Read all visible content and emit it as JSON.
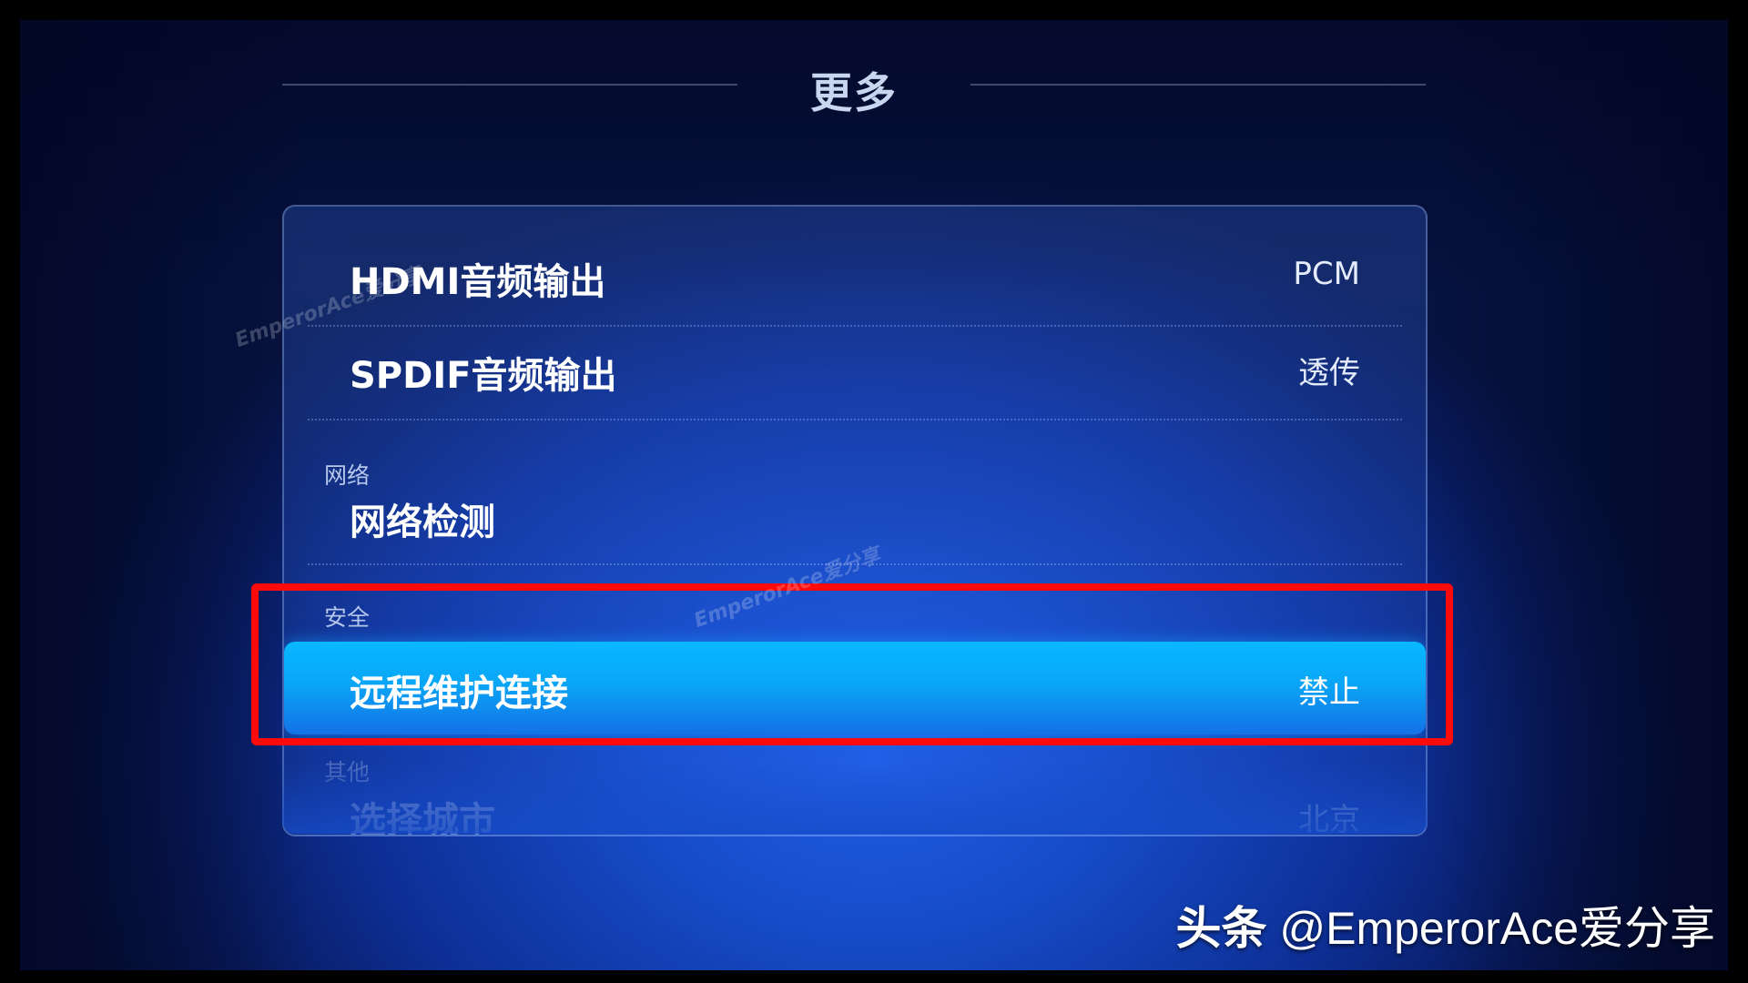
{
  "header": {
    "title": "更多"
  },
  "menu": {
    "hdmi_audio": {
      "label": "HDMI音频输出",
      "value": "PCM"
    },
    "spdif_audio": {
      "label": "SPDIF音频输出",
      "value": "透传"
    },
    "network_section": "网络",
    "network_check": {
      "label": "网络检测"
    },
    "security_section": "安全",
    "remote_maintenance": {
      "label": "远程维护连接",
      "value": "禁止"
    },
    "other_section": "其他",
    "select_city": {
      "label": "选择城市",
      "value": "北京"
    }
  },
  "overlay": {
    "highlight_color": "#ff0a0a",
    "watermark_1": "EmperorAce爱分享",
    "watermark_2": "EmperorAce爱分享",
    "attribution_brand": "头条",
    "attribution_handle": "@EmperorAce爱分享"
  },
  "colors": {
    "selected_row": "#0aa6f6",
    "background": "#164bc7"
  }
}
